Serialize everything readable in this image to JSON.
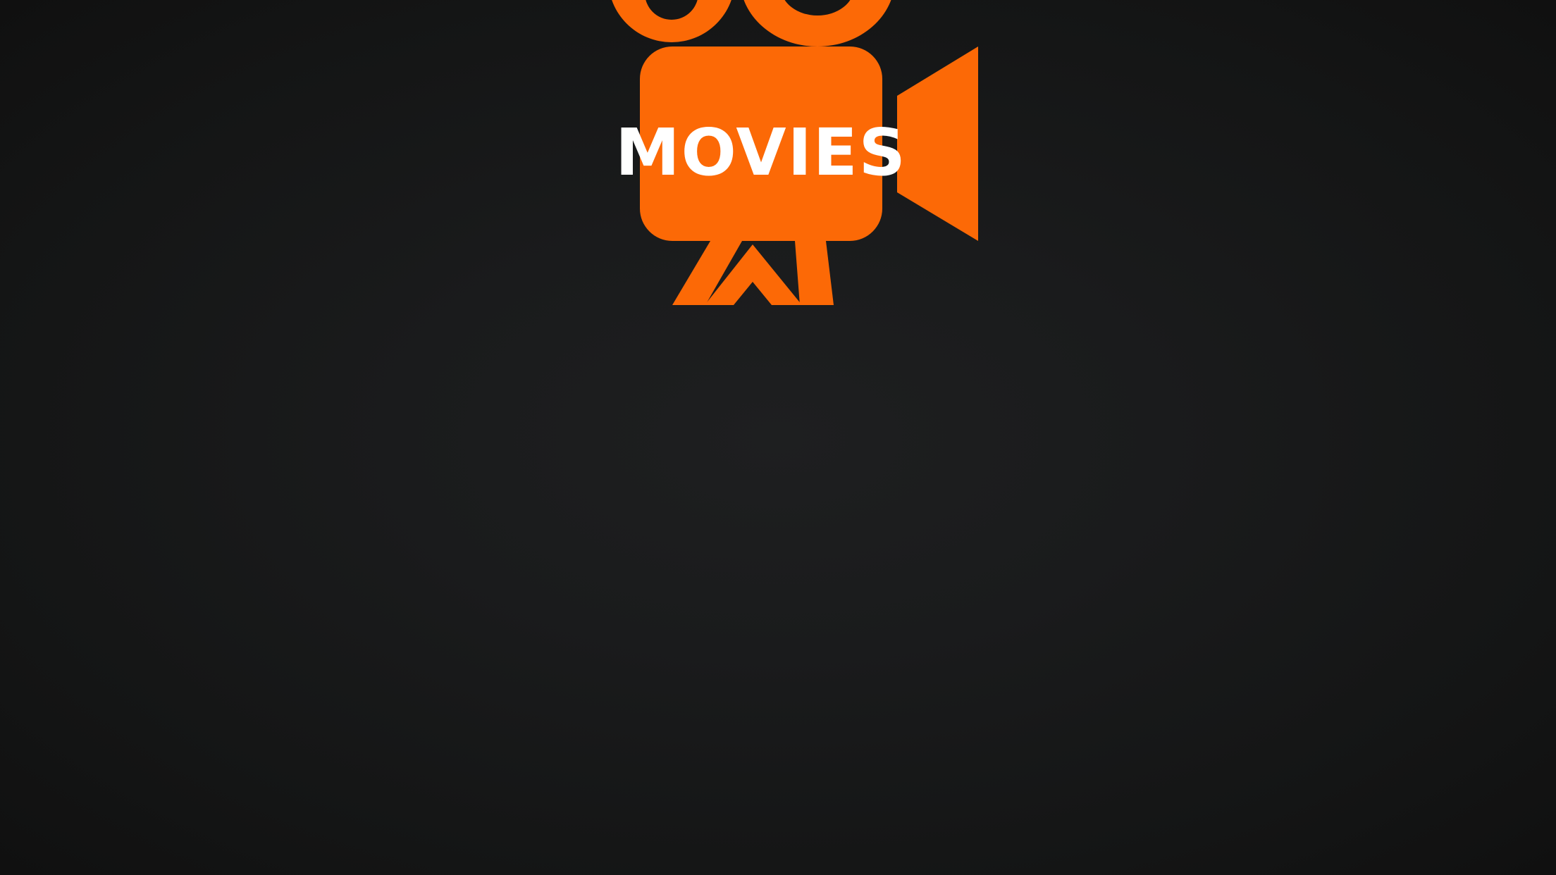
{
  "splash": {
    "logo_icon": "movie-camera-icon",
    "logo_text": "MOVIES",
    "colors": {
      "background": "#151616",
      "brand_orange": "#fc6906",
      "logo_text": "#ffffff"
    }
  }
}
